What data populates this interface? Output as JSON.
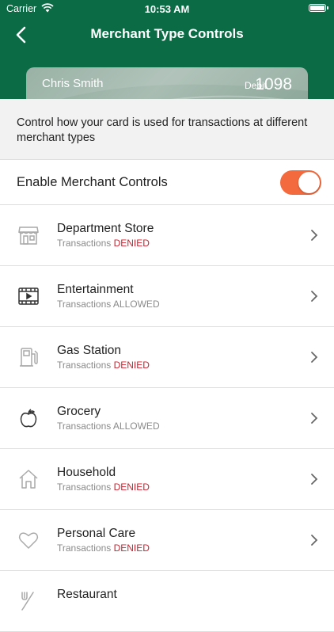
{
  "status_bar": {
    "carrier": "Carrier",
    "time": "10:53 AM"
  },
  "nav": {
    "title": "Merchant Type Controls"
  },
  "card": {
    "holder": "Chris Smith",
    "type": "Debit",
    "last4": "1098"
  },
  "intro": {
    "text": "Control how your card is used for transactions at different merchant types"
  },
  "merchant_controls": {
    "label": "Enable Merchant Controls",
    "enabled": true
  },
  "colors": {
    "header": "#0b6b45",
    "accent": "#f26a3d",
    "denied": "#d0202e"
  },
  "merchants": [
    {
      "name": "Department Store",
      "prefix": "Transactions",
      "status": "DENIED",
      "icon": "storefront-icon"
    },
    {
      "name": "Entertainment",
      "prefix": "Transactions",
      "status": "ALLOWED",
      "icon": "film-icon"
    },
    {
      "name": "Gas Station",
      "prefix": "Transactions",
      "status": "DENIED",
      "icon": "gas-pump-icon"
    },
    {
      "name": "Grocery",
      "prefix": "Transactions",
      "status": "ALLOWED",
      "icon": "apple-icon"
    },
    {
      "name": "Household",
      "prefix": "Transactions",
      "status": "DENIED",
      "icon": "house-icon"
    },
    {
      "name": "Personal Care",
      "prefix": "Transactions",
      "status": "DENIED",
      "icon": "heart-icon"
    },
    {
      "name": "Restaurant",
      "prefix": "",
      "status": "",
      "icon": "utensils-icon"
    }
  ]
}
